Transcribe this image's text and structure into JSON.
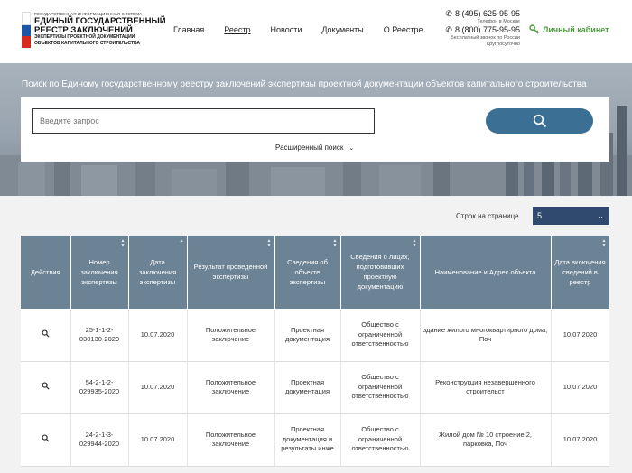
{
  "header": {
    "logo": {
      "small": "Государственная информационная система",
      "line1": "ЕДИНЫЙ ГОСУДАРСТВЕННЫЙ",
      "line2": "РЕЕСТР ЗАКЛЮЧЕНИЙ",
      "sub1": "ЭКСПЕРТИЗЫ ПРОЕКТНОЙ ДОКУМЕНТАЦИИ",
      "sub2": "ОБЪЕКТОВ КАПИТАЛЬНОГО СТРОИТЕЛЬСТВА",
      "flag_colors": [
        "#ffffff",
        "#1c57a5",
        "#d52b1e"
      ]
    },
    "nav": [
      {
        "label": "Главная"
      },
      {
        "label": "Реестр"
      },
      {
        "label": "Новости"
      },
      {
        "label": "Документы"
      },
      {
        "label": "О Реестре"
      }
    ],
    "phones": [
      {
        "number": "8 (495) 625-95-95",
        "note": "Телефон в Москве"
      },
      {
        "number": "8 (800) 775-95-95",
        "note": "Бесплатный звонок по России",
        "note2": "Круглосуточно"
      }
    ],
    "cabinet_label": "Личный кабинет"
  },
  "hero": {
    "title": "Поиск по Единому государственному реестру заключений экспертизы проектной документации объектов капитального строительства",
    "search_placeholder": "Введите запрос",
    "advanced_label": "Расширенный поиск"
  },
  "pagination": {
    "rows_label": "Строк на странице",
    "rows_value": "5"
  },
  "table": {
    "headers": [
      "Действия",
      "Номер заключения экспертизы",
      "Дата заключения экспертизы",
      "Результат проведенной экспертизы",
      "Сведения об объекте экспертизы",
      "Сведения о лицах, подготовивших проектную документацию",
      "Наименование и Адрес объекта",
      "Дата включения сведений в реестр"
    ],
    "rows": [
      {
        "number": "25-1-1-2-030130-2020",
        "date": "10.07.2020",
        "result": "Положительное заключение",
        "object": "Проектная документация",
        "persons": "Общество с ограниченной ответственностью",
        "name": "здание жилого многоквартирного дома, Поч",
        "included": "10.07.2020"
      },
      {
        "number": "54-2-1-2-029935-2020",
        "date": "10.07.2020",
        "result": "Положительное заключение",
        "object": "Проектная документация",
        "persons": "Общество с ограниченной ответственностью",
        "name": "Реконструкция незавершенного строительст",
        "included": "10.07.2020"
      },
      {
        "number": "24-2-1-3-029944-2020",
        "date": "10.07.2020",
        "result": "Положительное заключение",
        "object": "Проектная документация и результаты инже",
        "persons": "Общество с ограниченной ответственностью",
        "name": "Жилой дом № 10 строение 2, парковка, Поч",
        "included": "10.07.2020"
      }
    ]
  }
}
